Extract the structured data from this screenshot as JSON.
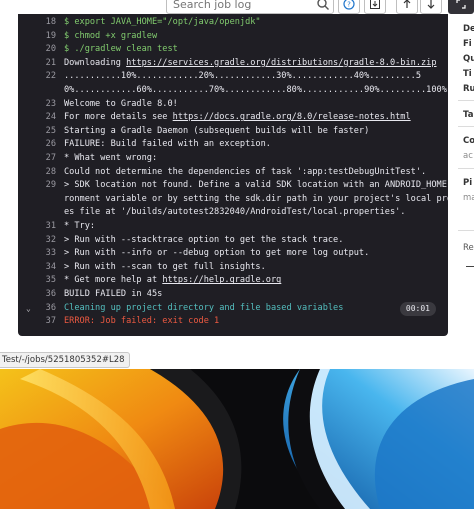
{
  "toolbar": {
    "search_placeholder": "Search job log",
    "buttons": [
      "help",
      "download",
      "scroll-top",
      "scroll-bottom",
      "fullscreen"
    ]
  },
  "log": {
    "lines": [
      {
        "n": "18",
        "t": "$ export JAVA_HOME=\"/opt/java/openjdk\"",
        "c": "green"
      },
      {
        "n": "19",
        "t": "$ chmod +x gradlew",
        "c": "green"
      },
      {
        "n": "20",
        "t": "$ ./gradlew clean test",
        "c": "green"
      },
      {
        "n": "21",
        "t": "Downloading https://services.gradle.org/distributions/gradle-8.0-bin.zip",
        "c": ""
      },
      {
        "n": "22",
        "t": "...........10%............20%............30%............40%.........5",
        "c": ""
      },
      {
        "n": "",
        "t": "0%............60%...........70%............80%............90%.........100%",
        "c": ""
      },
      {
        "n": "23",
        "t": "Welcome to Gradle 8.0!",
        "c": ""
      },
      {
        "n": "24",
        "t": "For more details see https://docs.gradle.org/8.0/release-notes.html",
        "c": ""
      },
      {
        "n": "25",
        "t": "Starting a Gradle Daemon (subsequent builds will be faster)",
        "c": ""
      },
      {
        "n": "26",
        "t": "FAILURE: Build failed with an exception.",
        "c": ""
      },
      {
        "n": "27",
        "t": "* What went wrong:",
        "c": ""
      },
      {
        "n": "28",
        "t": "Could not determine the dependencies of task ':app:testDebugUnitTest'.",
        "c": ""
      },
      {
        "n": "29",
        "t": "> SDK location not found. Define a valid SDK location with an ANDROID_HOME envi",
        "c": ""
      },
      {
        "n": "",
        "t": "ronment variable or by setting the sdk.dir path in your project's local properti",
        "c": ""
      },
      {
        "n": "",
        "t": "es file at '/builds/autotest2832040/AndroidTest/local.properties'.",
        "c": ""
      },
      {
        "n": "31",
        "t": "* Try:",
        "c": ""
      },
      {
        "n": "32",
        "t": "> Run with --stacktrace option to get the stack trace.",
        "c": ""
      },
      {
        "n": "33",
        "t": "> Run with --info or --debug option to get more log output.",
        "c": ""
      },
      {
        "n": "34",
        "t": "> Run with --scan to get full insights.",
        "c": ""
      },
      {
        "n": "35",
        "t": "* Get more help at https://help.gradle.org",
        "c": ""
      },
      {
        "n": "36",
        "t": "BUILD FAILED in 45s",
        "c": ""
      },
      {
        "n": "36",
        "t": "Cleaning up project directory and file based variables",
        "c": "cyan"
      },
      {
        "n": "37",
        "t": "ERROR: Job failed: exit code 1",
        "c": "red"
      }
    ],
    "duration": "00:01"
  },
  "sidebar": {
    "labels": [
      "De",
      "Fi",
      "Qu",
      "Ti",
      "Ru",
      "Ta",
      "Co",
      "ac",
      "Pi",
      "ma",
      "Re"
    ]
  },
  "statusbar": {
    "url": "Test/-/jobs/5251805352#L28"
  }
}
